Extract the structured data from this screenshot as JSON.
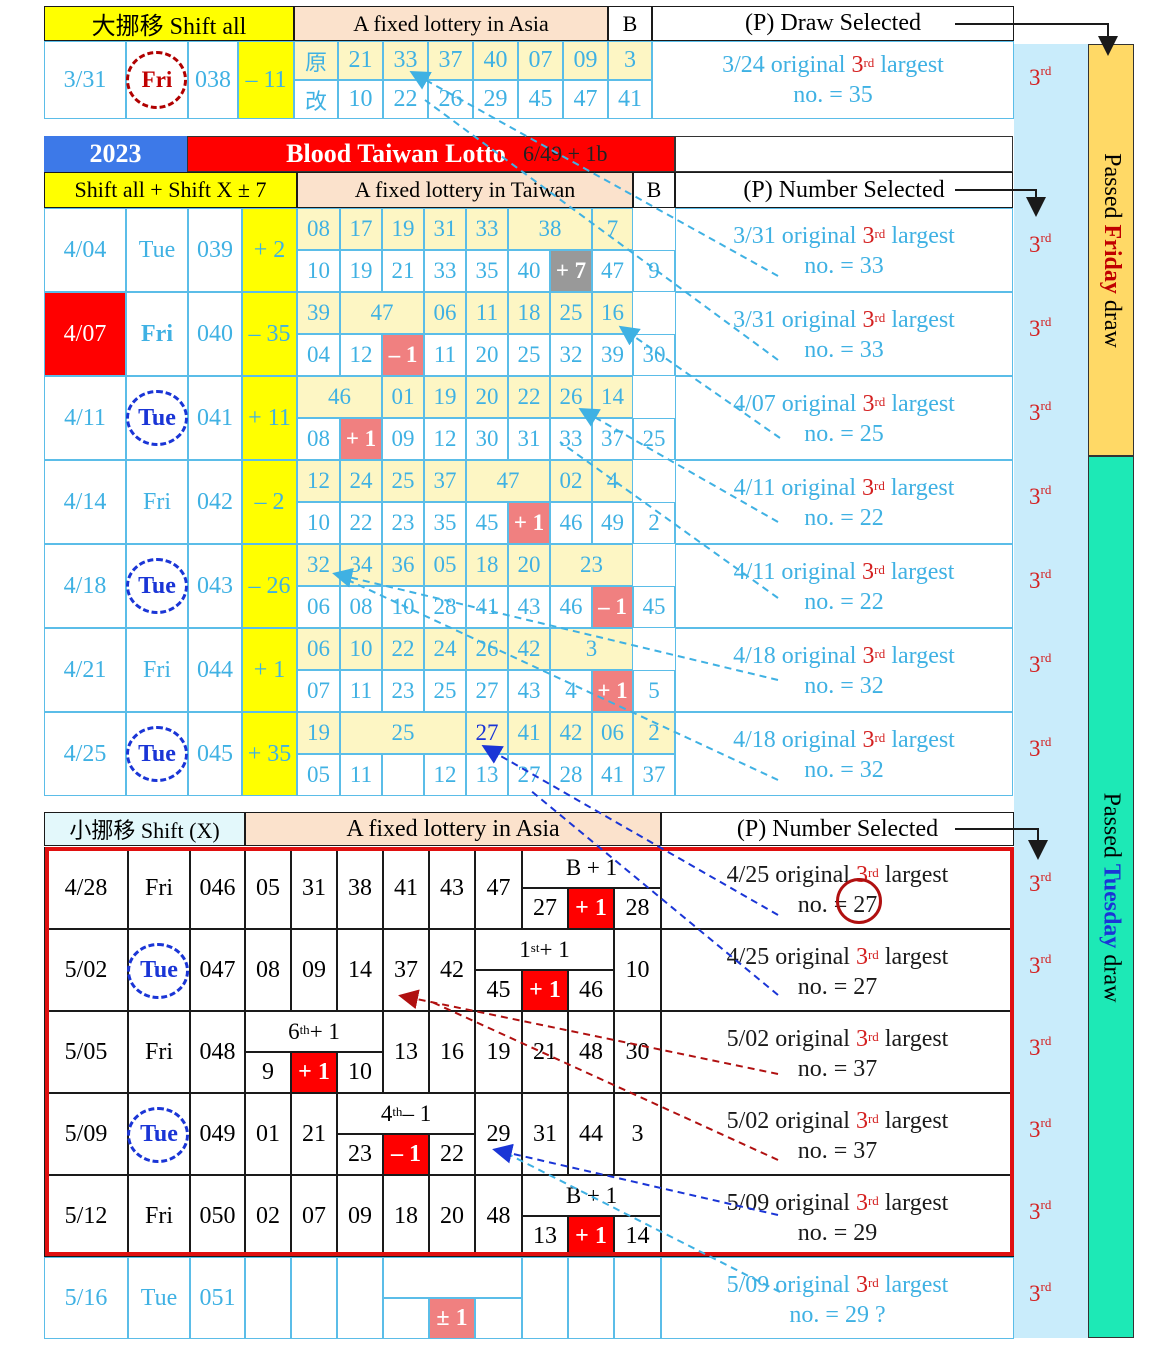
{
  "colors": {
    "cyan": "#3fb1e3",
    "yellow_band": "#ffff00",
    "pale_yellow": "#fdf6c4",
    "peach": "#fbe2cc",
    "red": "#ff0000",
    "pink": "#f08080",
    "gray": "#999999",
    "blue_header": "#3d79e8",
    "sidebar_yellow": "#ffd966",
    "sidebar_green": "#1de9b6",
    "sidebar_lightblue": "#c9ecfb"
  },
  "top": {
    "title": "大挪移 Shift all",
    "lottery": "A fixed lottery in Asia",
    "b": "B",
    "p": "(P) Draw Selected",
    "date": "3/31",
    "day": "Fri",
    "draw": "038",
    "shift": "– 11",
    "orig_label": "原",
    "mod_label": "改",
    "orig": [
      "21",
      "33",
      "37",
      "40",
      "07",
      "09",
      "3"
    ],
    "mod": [
      "10",
      "22",
      "26",
      "29",
      "45",
      "47",
      "41"
    ],
    "note1": "3/24 original ",
    "note_rank": "3",
    "note_sup": "rd",
    "note2": " largest",
    "note3": "no. = 35",
    "rank_side": "3",
    "rank_sup": "rd"
  },
  "mid": {
    "year": "2023",
    "title": "Blood  Taiwan Lotto",
    "format": "6/49 + 1b",
    "shift_label": "Shift all + Shift X ± 7",
    "lottery": "A fixed lottery in Taiwan",
    "b": "B",
    "p": "(P) Number Selected",
    "rows": [
      {
        "date": "4/04",
        "day": "Tue",
        "draw": "039",
        "shift": "+ 2",
        "top": [
          "08",
          "17",
          "19",
          "31",
          "33",
          "38",
          "7"
        ],
        "bot": [
          "10",
          "19",
          "21",
          "33",
          "35",
          "40",
          "+ 7",
          "47",
          "9"
        ],
        "note": "3/31 original",
        "no": "no. = 33"
      },
      {
        "date": "4/07",
        "day": "Fri",
        "draw": "040",
        "shift": "– 35",
        "top": [
          "39",
          "47",
          "06",
          "11",
          "18",
          "25",
          "16"
        ],
        "bot": [
          "04",
          "12",
          "– 1",
          "11",
          "20",
          "25",
          "32",
          "39",
          "30"
        ],
        "note": "3/31 original",
        "no": "no. = 33"
      },
      {
        "date": "4/11",
        "day": "Tue",
        "draw": "041",
        "shift": "+ 11",
        "top": [
          "46",
          "01",
          "19",
          "20",
          "22",
          "26",
          "14"
        ],
        "bot": [
          "08",
          "+ 1",
          "09",
          "12",
          "30",
          "31",
          "33",
          "37",
          "25"
        ],
        "note": "4/07 original",
        "no": "no. = 25"
      },
      {
        "date": "4/14",
        "day": "Fri",
        "draw": "042",
        "shift": "– 2",
        "top": [
          "12",
          "24",
          "25",
          "37",
          "47",
          "02",
          "4"
        ],
        "bot": [
          "10",
          "22",
          "23",
          "35",
          "45",
          "+ 1",
          "46",
          "49",
          "2"
        ],
        "note": "4/11 original",
        "no": "no. = 22"
      },
      {
        "date": "4/18",
        "day": "Tue",
        "draw": "043",
        "shift": "– 26",
        "top": [
          "32",
          "34",
          "36",
          "05",
          "18",
          "20",
          "23"
        ],
        "bot": [
          "06",
          "08",
          "10",
          "28",
          "41",
          "43",
          "46",
          "– 1",
          "45"
        ],
        "note": "4/11 original",
        "no": "no. = 22"
      },
      {
        "date": "4/21",
        "day": "Fri",
        "draw": "044",
        "shift": "+ 1",
        "top": [
          "06",
          "10",
          "22",
          "24",
          "26",
          "42",
          "3"
        ],
        "bot": [
          "07",
          "11",
          "23",
          "25",
          "27",
          "43",
          "4",
          "+ 1",
          "5"
        ],
        "note": "4/18 original",
        "no": "no. = 32"
      },
      {
        "date": "4/25",
        "day": "Tue",
        "draw": "045",
        "shift": "+ 35",
        "top": [
          "19",
          "25",
          "27",
          "41",
          "42",
          "06",
          "2"
        ],
        "bot": [
          "05",
          "11",
          "12",
          "13",
          "27",
          "28",
          "41",
          "37"
        ],
        "note": "4/18 original",
        "no": "no. = 32"
      }
    ]
  },
  "bottom": {
    "shift_label": "小挪移 Shift (X)",
    "lottery": "A fixed lottery in Asia",
    "p": "(P) Number Selected",
    "rows": [
      {
        "date": "4/28",
        "day": "Fri",
        "draw": "046",
        "nums": [
          "05",
          "31",
          "38",
          "41",
          "43",
          "47"
        ],
        "grp": "B + 1",
        "a": "27",
        "m": "+ 1",
        "b": "28",
        "note": "4/25 original",
        "no": "no. = 27"
      },
      {
        "date": "5/02",
        "day": "Tue",
        "draw": "047",
        "nums": [
          "08",
          "09",
          "14",
          "37",
          "42",
          "10"
        ],
        "grp": "1",
        "grp_sup": "st",
        "grp_tail": " + 1",
        "a": "45",
        "m": "+ 1",
        "b": "46",
        "note": "4/25 original",
        "no": "no. = 27"
      },
      {
        "date": "5/05",
        "day": "Fri",
        "draw": "048",
        "nums": [
          "13",
          "16",
          "19",
          "21",
          "48",
          "30"
        ],
        "grp": "6",
        "grp_sup": "th",
        "grp_tail": " + 1",
        "a": "9",
        "m": "+ 1",
        "b": "10",
        "note": "5/02 original",
        "no": "no. = 37"
      },
      {
        "date": "5/09",
        "day": "Tue",
        "draw": "049",
        "nums": [
          "01",
          "21",
          "29",
          "31",
          "44",
          "3"
        ],
        "grp": "4",
        "grp_sup": "th",
        "grp_tail": " – 1",
        "a": "23",
        "m": "– 1",
        "b": "22",
        "note": "5/02 original",
        "no": "no. = 37"
      },
      {
        "date": "5/12",
        "day": "Fri",
        "draw": "050",
        "nums": [
          "02",
          "07",
          "09",
          "18",
          "20",
          "48"
        ],
        "grp": "B + 1",
        "a": "13",
        "m": "+ 1",
        "b": "14",
        "note": "5/09 original",
        "no": "no. = 29"
      }
    ],
    "last": {
      "date": "5/16",
      "day": "Tue",
      "draw": "051",
      "m": "± 1",
      "note": "5/09 original",
      "no": "no. = 29 ?"
    }
  },
  "common": {
    "rank": "3",
    "sup": "rd",
    "largest": " largest"
  },
  "sidebar": {
    "friday_pre": "Passed ",
    "friday_word": "Friday",
    "friday_post": " draw",
    "tuesday_pre": "Passed ",
    "tuesday_word": "Tuesday",
    "tuesday_post": " draw"
  }
}
